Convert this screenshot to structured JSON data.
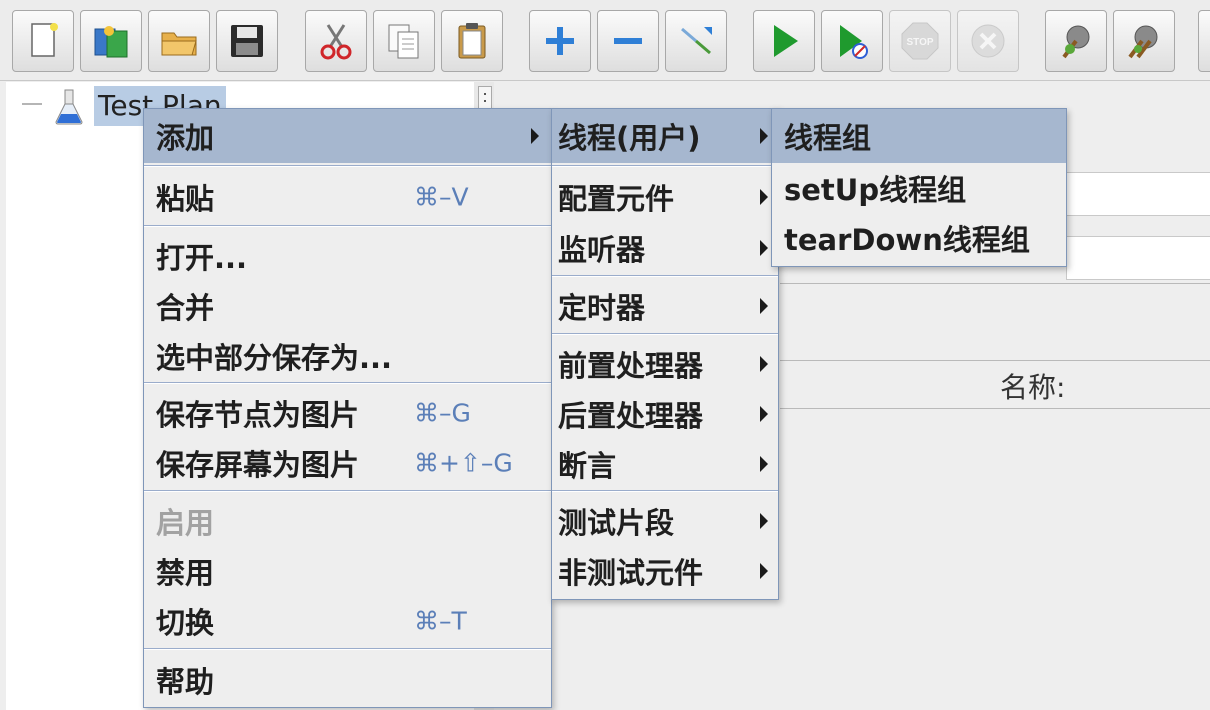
{
  "toolbar": {
    "buttons": [
      {
        "icon": "new-icon"
      },
      {
        "icon": "templates-icon"
      },
      {
        "icon": "open-icon"
      },
      {
        "icon": "save-icon"
      },
      {
        "icon": "cut-icon"
      },
      {
        "icon": "copy-icon"
      },
      {
        "icon": "paste-icon"
      },
      {
        "icon": "expand-icon"
      },
      {
        "icon": "collapse-icon"
      },
      {
        "icon": "toggle-icon"
      },
      {
        "icon": "start-icon"
      },
      {
        "icon": "start-no-pauses-icon"
      },
      {
        "icon": "stop-icon"
      },
      {
        "icon": "shutdown-icon"
      },
      {
        "icon": "clear-icon"
      },
      {
        "icon": "clear-all-icon"
      }
    ]
  },
  "tree": {
    "root_label": "Test Plan"
  },
  "right_panel": {
    "name_label": "名称:"
  },
  "context_menu": {
    "add": "添加",
    "paste": "粘贴",
    "paste_shortcut": "⌘–V",
    "open": "打开...",
    "merge": "合并",
    "save_selection": "选中部分保存为...",
    "save_node_image": "保存节点为图片",
    "save_node_image_shortcut": "⌘–G",
    "save_screen_image": "保存屏幕为图片",
    "save_screen_image_shortcut": "⌘+⇧–G",
    "enable": "启用",
    "disable": "禁用",
    "toggle": "切换",
    "toggle_shortcut": "⌘–T",
    "help": "帮助"
  },
  "add_submenu": {
    "threads": "线程(用户)",
    "config": "配置元件",
    "listener": "监听器",
    "timer": "定时器",
    "preprocessor": "前置处理器",
    "postprocessor": "后置处理器",
    "assertion": "断言",
    "test_fragment": "测试片段",
    "non_test_elements": "非测试元件"
  },
  "threads_submenu": {
    "thread_group": "线程组",
    "setup_thread_group": "setUp线程组",
    "teardown_thread_group": "tearDown线程组"
  },
  "colors": {
    "menu_selected": "#a6b7cf",
    "menu_border": "#7f96b8",
    "shortcut": "#5b7fb8",
    "tree_selected": "#b8cce4"
  }
}
